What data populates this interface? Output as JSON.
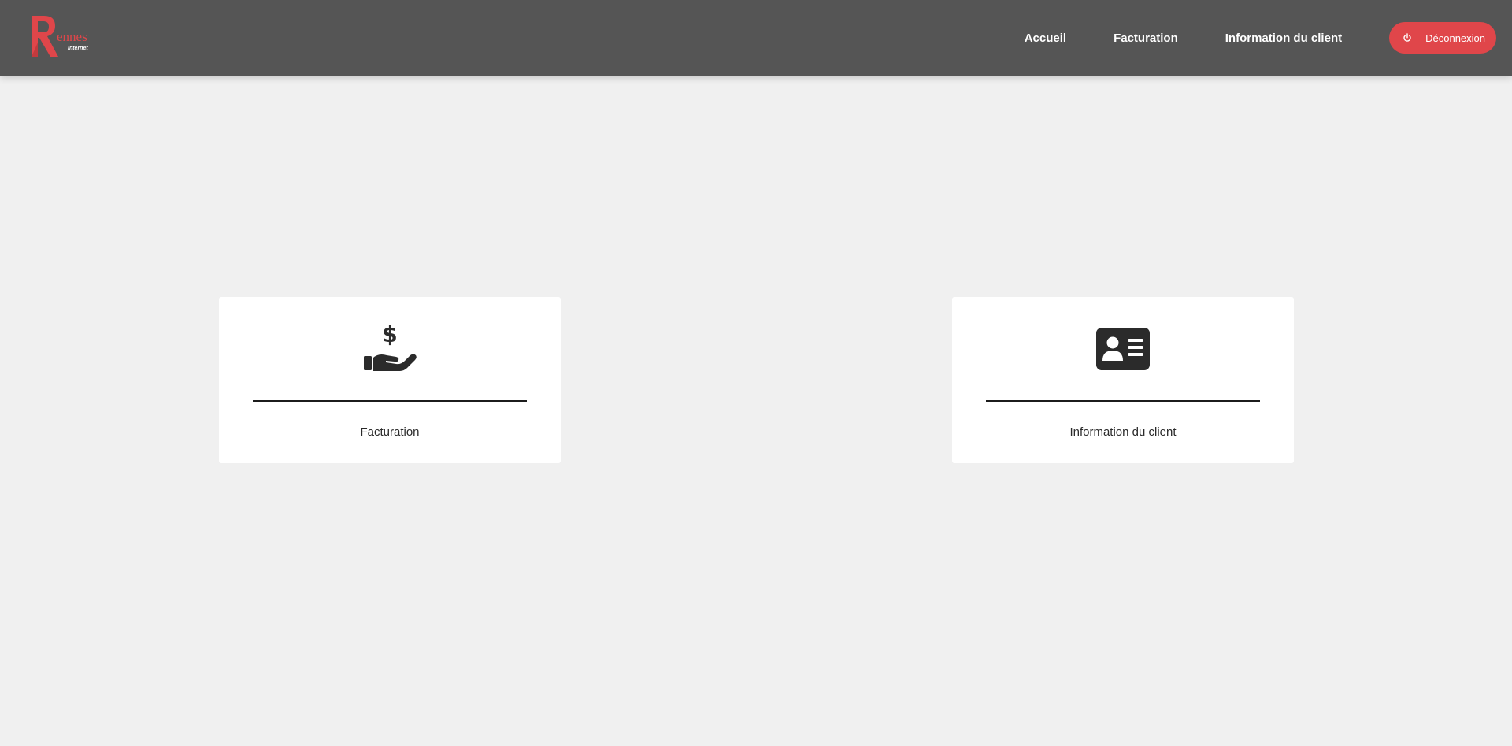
{
  "brand": {
    "logo_main": "ennes",
    "logo_sub": "internet",
    "accent": "#e0464a"
  },
  "nav": {
    "items": [
      {
        "label": "Accueil"
      },
      {
        "label": "Facturation"
      },
      {
        "label": "Information du client"
      }
    ],
    "logout_label": "Déconnexion",
    "logout_icon": "power-icon"
  },
  "cards": [
    {
      "label": "Facturation",
      "icon": "hand-dollar-icon"
    },
    {
      "label": "Information du client",
      "icon": "id-card-icon"
    }
  ],
  "colors": {
    "topbar": "#555555",
    "background": "#f0f0f0",
    "card": "#ffffff",
    "icon": "#2b2b2b"
  }
}
